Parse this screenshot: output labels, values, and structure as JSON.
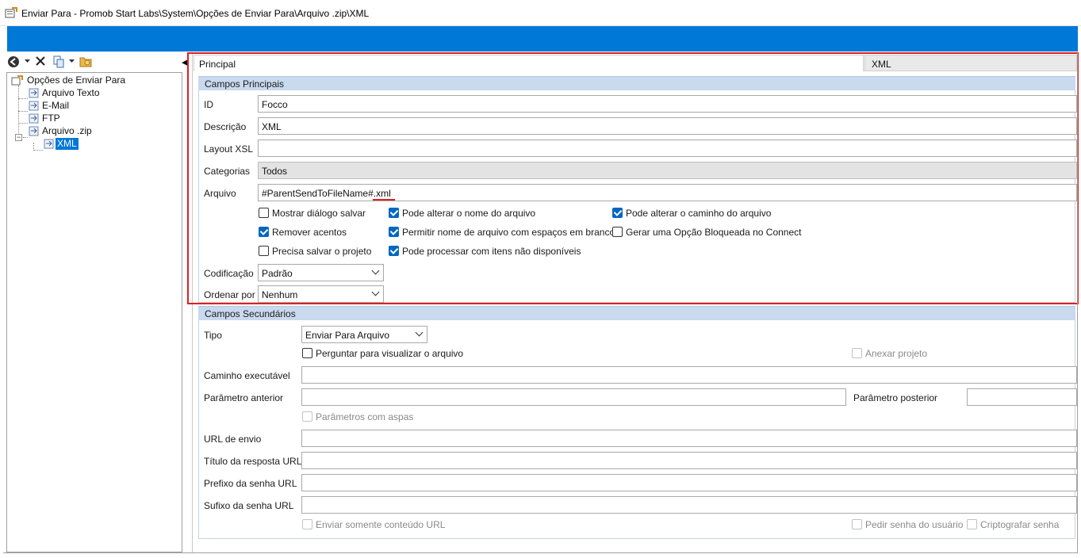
{
  "window": {
    "title": "Enviar Para - Promob Start Labs\\System\\Opções de Enviar Para\\Arquivo .zip\\XML"
  },
  "accent_color": "#0078d7",
  "highlight_color": "#e01f1f",
  "toolbar": {
    "icons": [
      "back-icon",
      "dropdown-icon",
      "delete-icon",
      "copy-icon",
      "dropdown-icon",
      "folder-icon"
    ]
  },
  "tree": {
    "root": "Opções de Enviar Para",
    "items": [
      "Arquivo Texto",
      "E-Mail",
      "FTP",
      "Arquivo .zip"
    ],
    "child": "XML"
  },
  "tabs": {
    "principal": "Principal",
    "xml": "XML"
  },
  "principal": {
    "header": "Campos Principais",
    "id_label": "ID",
    "id_value": "Focco",
    "descricao_label": "Descrição",
    "descricao_value": "XML",
    "layout_label": "Layout XSL",
    "layout_value": "",
    "categorias_label": "Categorias",
    "categorias_value": "Todos",
    "arquivo_label": "Arquivo",
    "arquivo_value": "#ParentSendToFileName#.xml",
    "checkboxes": [
      {
        "label": "Mostrar diálogo salvar",
        "checked": false
      },
      {
        "label": "Pode alterar o nome do arquivo",
        "checked": true
      },
      {
        "label": "Pode alterar o caminho do arquivo",
        "checked": true
      },
      {
        "label": "Remover acentos",
        "checked": true
      },
      {
        "label": "Permitir nome de arquivo com espaços em branco",
        "checked": true
      },
      {
        "label": "Gerar uma Opção Bloqueada no Connect",
        "checked": false
      },
      {
        "label": "Precisa salvar o projeto",
        "checked": false
      },
      {
        "label": "Pode processar com itens não disponíveis",
        "checked": true
      }
    ],
    "codificacao_label": "Codificação",
    "codificacao_value": "Padrão",
    "ordenar_label": "Ordenar por",
    "ordenar_value": "Nenhum"
  },
  "secundarios": {
    "header": "Campos Secundários",
    "tipo_label": "Tipo",
    "tipo_value": "Enviar Para Arquivo",
    "perguntar_label": "Perguntar para visualizar o arquivo",
    "anexar_label": "Anexar projeto",
    "caminho_label": "Caminho executável",
    "param_anterior_label": "Parâmetro anterior",
    "param_posterior_label": "Parâmetro posterior",
    "param_aspas_label": "Parâmetros com aspas",
    "url_envio_label": "URL de envio",
    "titulo_resposta_label": "Título da resposta URL",
    "prefixo_senha_label": "Prefixo da senha URL",
    "sufixo_senha_label": "Sufixo da senha URL",
    "enviar_somente_label": "Enviar somente conteúdo URL",
    "pedir_senha_label": "Pedir senha do usuário",
    "criptografar_label": "Criptografar senha"
  }
}
